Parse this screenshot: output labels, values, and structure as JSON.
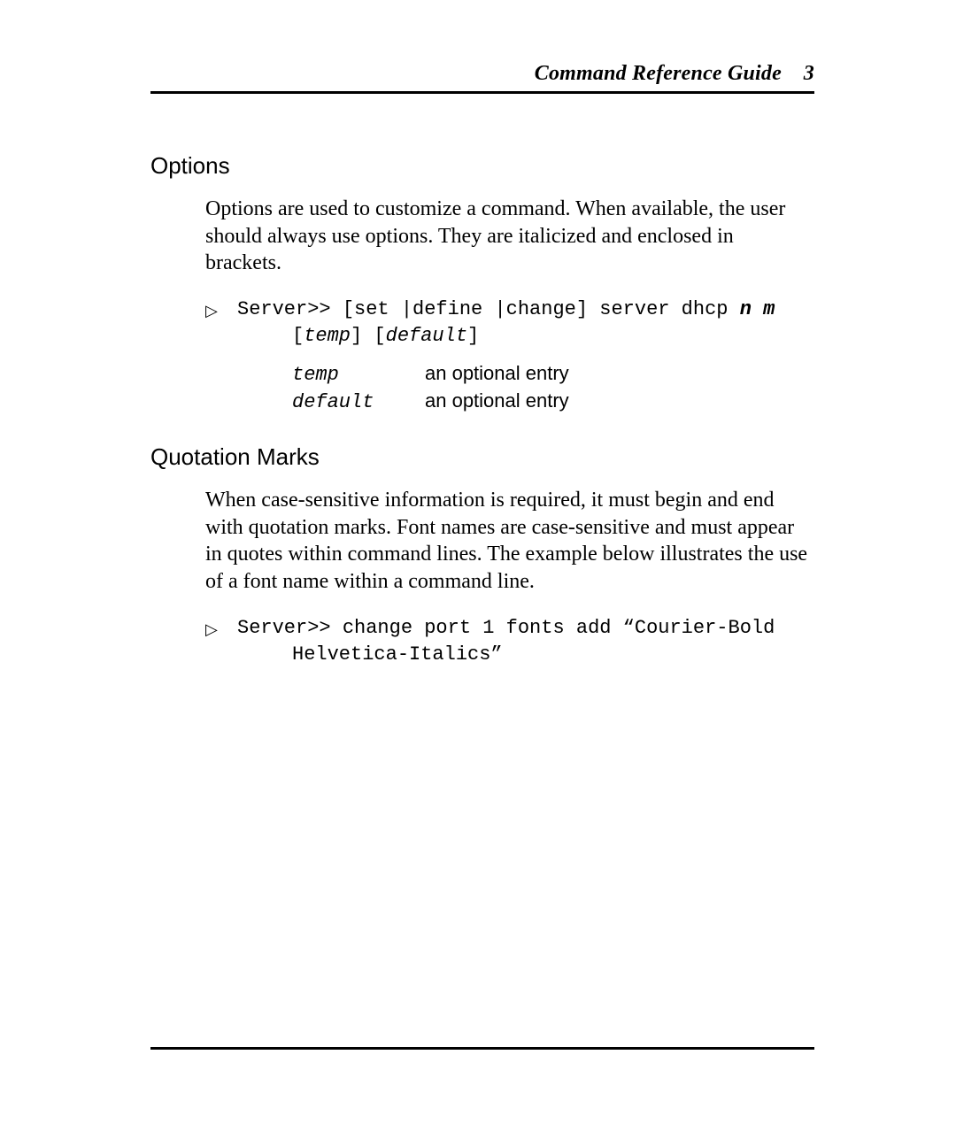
{
  "header": {
    "title": "Command Reference Guide",
    "page_number": "3"
  },
  "sections": {
    "options": {
      "title": "Options",
      "para": "Options are used to customize a command. When available, the user should always use options.  They are italicized and enclosed in brackets.",
      "example": {
        "prefix": "Server>> [set |define |change] server dhcp ",
        "args": "n m",
        "line2_open": "[",
        "line2_a": "temp",
        "line2_mid": "] [",
        "line2_b": "default",
        "line2_close": "]"
      },
      "rows": [
        {
          "term": "temp",
          "desc": "an optional entry"
        },
        {
          "term": "default",
          "desc": "an optional entry"
        }
      ]
    },
    "quotes": {
      "title": "Quotation Marks",
      "para": "When case-sensitive information is required, it must begin and end with quotation marks.  Font names are case-sensitive and must appear in quotes within command lines.  The example below illustrates the use of a font name within a command line.",
      "example_line1": "Server>> change port 1 fonts add “Courier-Bold",
      "example_line2": "Helvetica-Italics”"
    }
  },
  "glyphs": {
    "triangle": "▷"
  }
}
